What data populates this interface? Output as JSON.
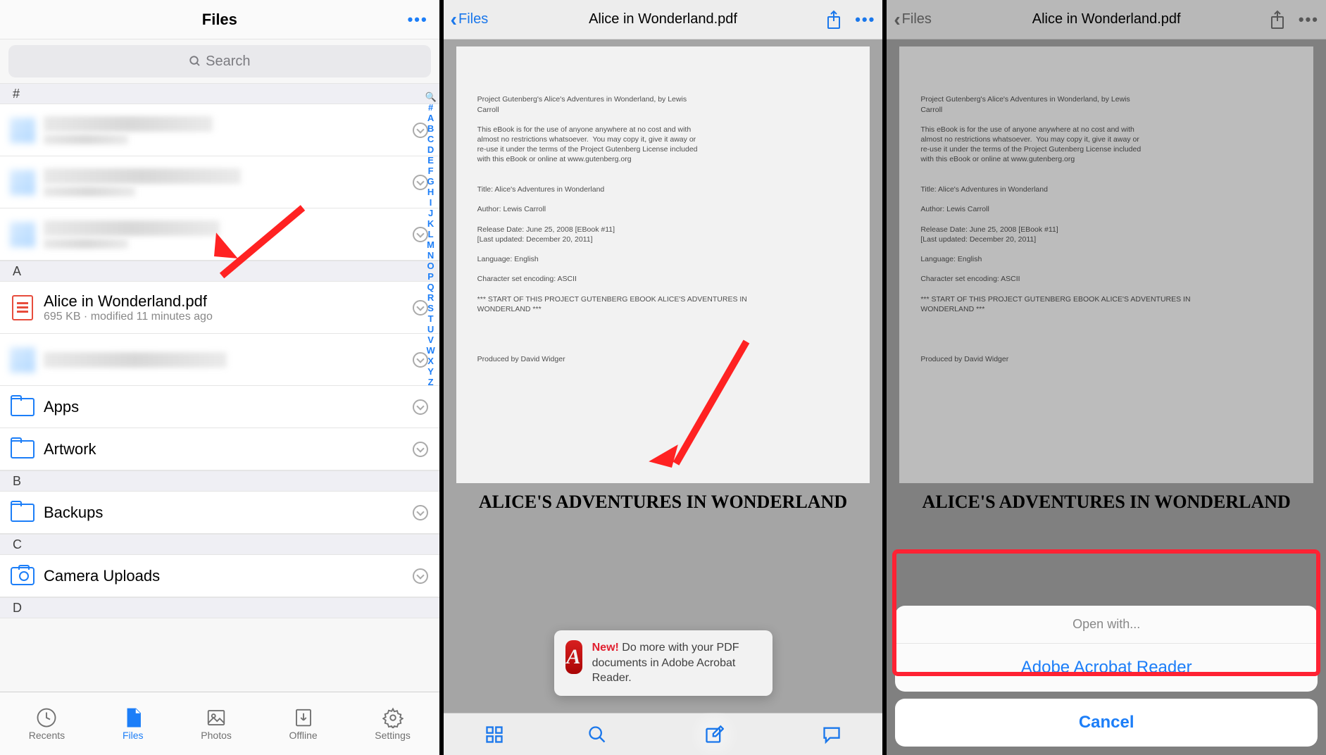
{
  "screen1": {
    "title": "Files",
    "moreDots": "•••",
    "searchPlaceholder": "Search",
    "sections": [
      "#",
      "A",
      "B",
      "C",
      "D"
    ],
    "fileItem": {
      "name": "Alice in Wonderland.pdf",
      "meta": "695 KB · modified 11 minutes ago"
    },
    "folders": {
      "apps": "Apps",
      "artwork": "Artwork",
      "backups": "Backups",
      "camera": "Camera Uploads"
    },
    "index": [
      "🔍",
      "#",
      "A",
      "B",
      "C",
      "D",
      "E",
      "F",
      "G",
      "H",
      "I",
      "J",
      "K",
      "L",
      "M",
      "N",
      "O",
      "P",
      "Q",
      "R",
      "S",
      "T",
      "U",
      "V",
      "W",
      "X",
      "Y",
      "Z"
    ],
    "tabs": {
      "recents": "Recents",
      "files": "Files",
      "photos": "Photos",
      "offline": "Offline",
      "settings": "Settings"
    }
  },
  "preview": {
    "backLabel": "Files",
    "docTitle": "Alice in Wonderland.pdf",
    "moreDots": "•••",
    "pageText": "Project Gutenberg's Alice's Adventures in Wonderland, by Lewis\nCarroll\n\nThis eBook is for the use of anyone anywhere at no cost and with\nalmost no restrictions whatsoever.  You may copy it, give it away or\nre-use it under the terms of the Project Gutenberg License included\nwith this eBook or online at www.gutenberg.org\n\n\nTitle: Alice's Adventures in Wonderland\n\nAuthor: Lewis Carroll\n\nRelease Date: June 25, 2008 [EBook #11]\n[Last updated: December 20, 2011]\n\nLanguage: English\n\nCharacter set encoding: ASCII\n\n*** START OF THIS PROJECT GUTENBERG EBOOK ALICE'S ADVENTURES IN\nWONDERLAND ***\n\n\n\n\nProduced by David Widger",
    "bigTitle": "ALICE'S ADVENTURES IN WONDERLAND",
    "tip": {
      "new": "New!",
      "body": " Do more with your PDF documents in Adobe Acrobat Reader."
    }
  },
  "sheet": {
    "header": "Open with...",
    "option1": "Adobe Acrobat Reader",
    "cancel": "Cancel"
  }
}
